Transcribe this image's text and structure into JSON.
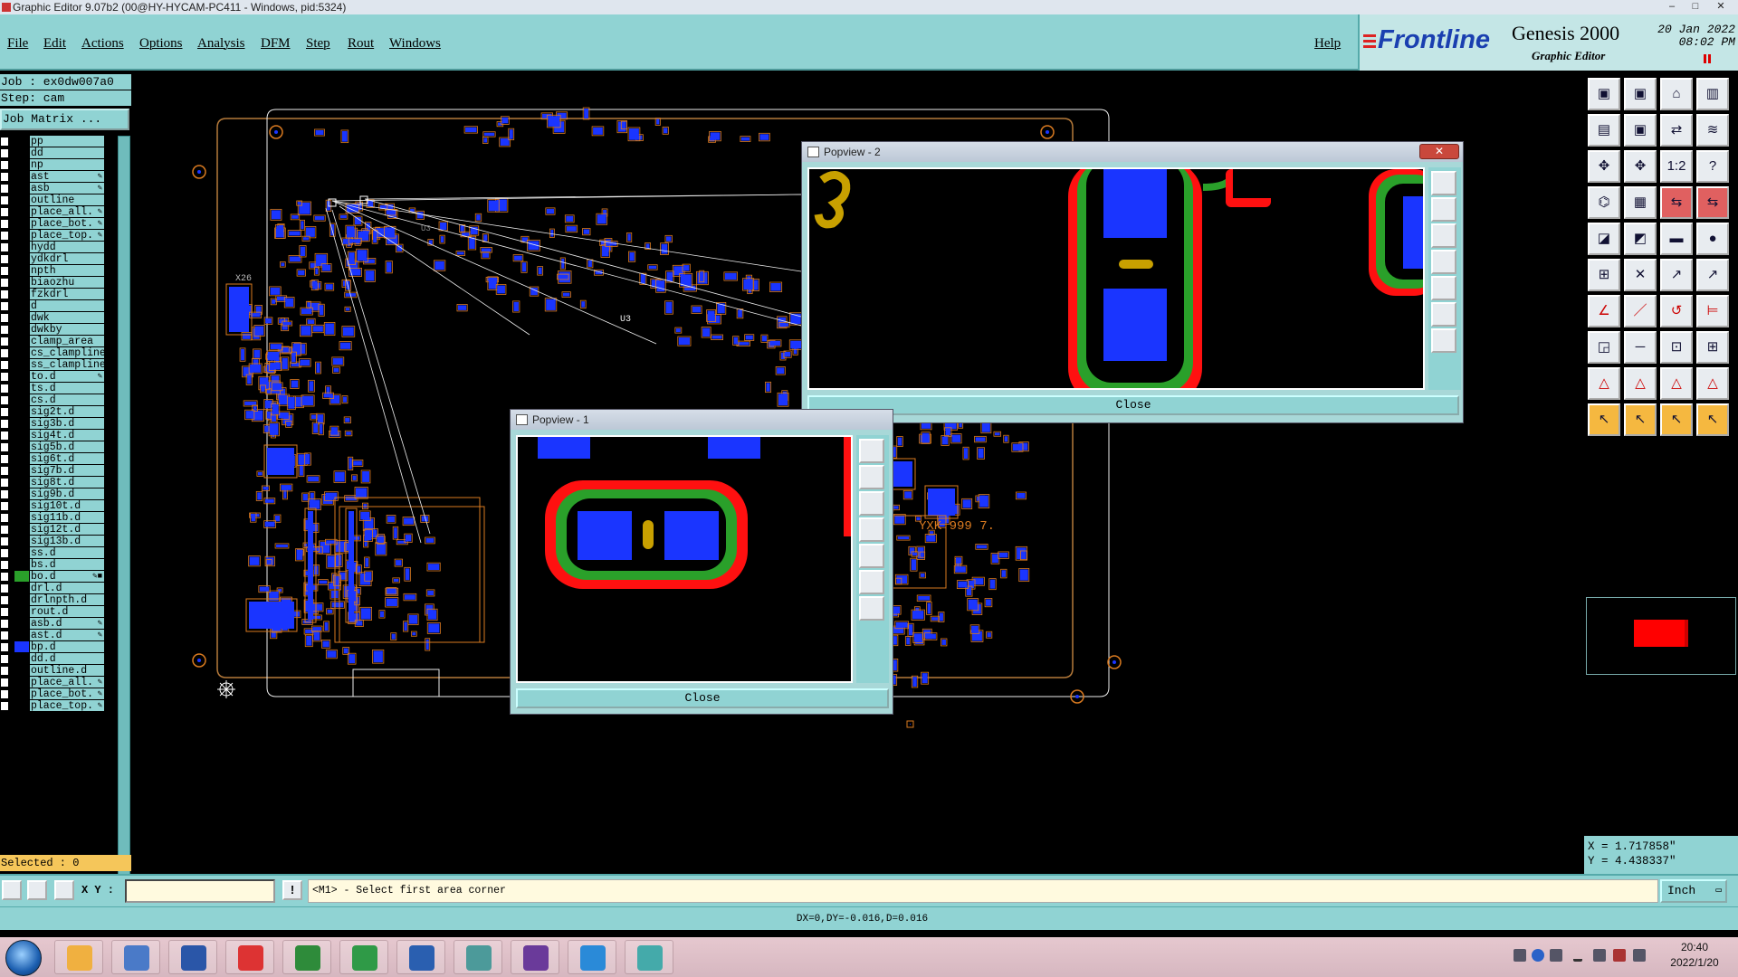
{
  "window": {
    "title": "Graphic Editor 9.07b2 (00@HY-HYCAM-PC411 - Windows, pid:5324)",
    "controls": [
      "–",
      "□",
      "✕"
    ]
  },
  "menu": {
    "items": [
      "File",
      "Edit",
      "Actions",
      "Options",
      "Analysis",
      "DFM",
      "Step",
      "Rout",
      "Windows"
    ],
    "help": "Help"
  },
  "brand": {
    "logo": "Frontline",
    "product": "Genesis 2000",
    "subtitle": "Graphic Editor",
    "date": "20 Jan 2022",
    "time": "08:02 PM"
  },
  "left_panel": {
    "job": "Job : ex0dw007a0",
    "step": "Step: cam",
    "job_matrix": "Job Matrix ...",
    "selected": "Selected : 0",
    "layers": [
      {
        "name": "pp",
        "color": "",
        "mark": ""
      },
      {
        "name": "dd",
        "color": "",
        "mark": ""
      },
      {
        "name": "np",
        "color": "",
        "mark": ""
      },
      {
        "name": "ast",
        "color": "",
        "mark": "✎"
      },
      {
        "name": "asb",
        "color": "",
        "mark": "✎"
      },
      {
        "name": "outline",
        "color": "",
        "mark": ""
      },
      {
        "name": "place_all.",
        "color": "",
        "mark": "✎"
      },
      {
        "name": "place_bot.",
        "color": "",
        "mark": "✎"
      },
      {
        "name": "place_top.",
        "color": "",
        "mark": "✎"
      },
      {
        "name": "hydd",
        "color": "",
        "mark": ""
      },
      {
        "name": "ydkdrl",
        "color": "",
        "mark": ""
      },
      {
        "name": "npth",
        "color": "",
        "mark": ""
      },
      {
        "name": "biaozhu",
        "color": "",
        "mark": ""
      },
      {
        "name": "fzkdrl",
        "color": "",
        "mark": ""
      },
      {
        "name": "d",
        "color": "",
        "mark": ""
      },
      {
        "name": "dwk",
        "color": "",
        "mark": ""
      },
      {
        "name": "dwkby",
        "color": "",
        "mark": ""
      },
      {
        "name": "clamp_area",
        "color": "",
        "mark": ""
      },
      {
        "name": "cs_clampline",
        "color": "",
        "mark": ""
      },
      {
        "name": "ss_clampline",
        "color": "",
        "mark": ""
      },
      {
        "name": "to.d",
        "color": "",
        "mark": "✎"
      },
      {
        "name": "ts.d",
        "color": "",
        "mark": ""
      },
      {
        "name": "cs.d",
        "color": "",
        "mark": ""
      },
      {
        "name": "sig2t.d",
        "color": "",
        "mark": ""
      },
      {
        "name": "sig3b.d",
        "color": "",
        "mark": ""
      },
      {
        "name": "sig4t.d",
        "color": "",
        "mark": ""
      },
      {
        "name": "sig5b.d",
        "color": "",
        "mark": ""
      },
      {
        "name": "sig6t.d",
        "color": "",
        "mark": ""
      },
      {
        "name": "sig7b.d",
        "color": "",
        "mark": ""
      },
      {
        "name": "sig8t.d",
        "color": "",
        "mark": ""
      },
      {
        "name": "sig9b.d",
        "color": "",
        "mark": ""
      },
      {
        "name": "sig10t.d",
        "color": "",
        "mark": ""
      },
      {
        "name": "sig11b.d",
        "color": "",
        "mark": ""
      },
      {
        "name": "sig12t.d",
        "color": "",
        "mark": ""
      },
      {
        "name": "sig13b.d",
        "color": "",
        "mark": ""
      },
      {
        "name": "ss.d",
        "color": "",
        "mark": ""
      },
      {
        "name": "bs.d",
        "color": "",
        "mark": ""
      },
      {
        "name": "bo.d",
        "color": "#2aa02a",
        "mark": "✎■"
      },
      {
        "name": "drl.d",
        "color": "",
        "mark": ""
      },
      {
        "name": "drlnpth.d",
        "color": "",
        "mark": ""
      },
      {
        "name": "rout.d",
        "color": "",
        "mark": ""
      },
      {
        "name": "asb.d",
        "color": "",
        "mark": "✎"
      },
      {
        "name": "ast.d",
        "color": "",
        "mark": "✎"
      },
      {
        "name": "bp.d",
        "color": "#1a35ff",
        "mark": ""
      },
      {
        "name": "dd.d",
        "color": "",
        "mark": ""
      },
      {
        "name": "outline.d",
        "color": "",
        "mark": ""
      },
      {
        "name": "place_all.",
        "color": "",
        "mark": "✎"
      },
      {
        "name": "place_bot.",
        "color": "",
        "mark": "✎"
      },
      {
        "name": "place_top.",
        "color": "",
        "mark": "✎"
      }
    ]
  },
  "canvas": {
    "labels": [
      "YXK 999 7.",
      "U3",
      "U3",
      "X26"
    ]
  },
  "popview1": {
    "title": "Popview - 1",
    "close_label": "Close"
  },
  "popview2": {
    "title": "Popview - 2",
    "close_label": "Close"
  },
  "coords": {
    "x": "X = 1.717858\"",
    "y": "Y = 4.438337\""
  },
  "status": {
    "xy_label": "X Y :",
    "xy_value": "",
    "prompt": "<M1> - Select first area corner",
    "units": "Inch",
    "message": "DX=0,DY=-0.016,D=0.016"
  },
  "taskbar": {
    "time": "20:40",
    "date": "2022/1/20"
  },
  "colors": {
    "panel": "#90d3d3",
    "pad_blue": "#1a35ff",
    "mask_green": "#2aa02a",
    "mask_red": "#ff1010",
    "outline_orange": "#d97a20",
    "yellow": "#d4a800"
  }
}
